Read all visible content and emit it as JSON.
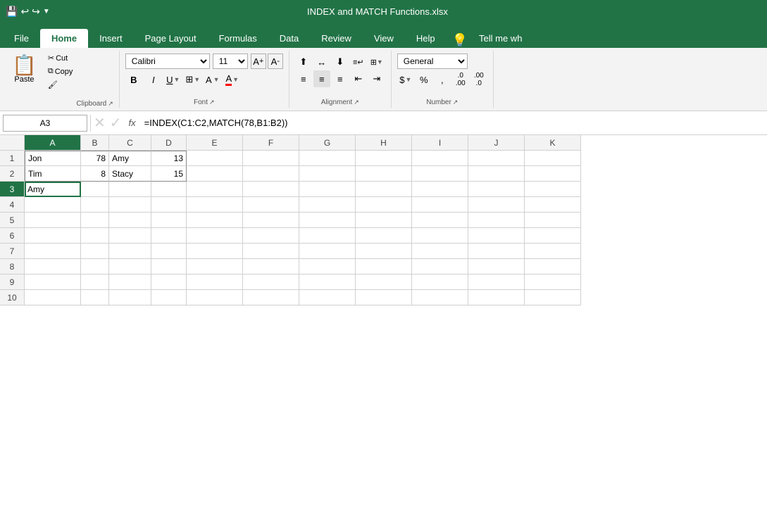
{
  "titlebar": {
    "title": "INDEX and MATCH Functions.xlsx",
    "save_icon": "💾",
    "undo_icon": "↩",
    "redo_icon": "↪"
  },
  "ribbon_tabs": [
    {
      "label": "File",
      "active": false
    },
    {
      "label": "Home",
      "active": true
    },
    {
      "label": "Insert",
      "active": false
    },
    {
      "label": "Page Layout",
      "active": false
    },
    {
      "label": "Formulas",
      "active": false
    },
    {
      "label": "Data",
      "active": false
    },
    {
      "label": "Review",
      "active": false
    },
    {
      "label": "View",
      "active": false
    },
    {
      "label": "Help",
      "active": false
    },
    {
      "label": "Tell me wh",
      "active": false
    }
  ],
  "ribbon": {
    "clipboard": {
      "label": "Clipboard",
      "paste_label": "Paste",
      "cut_label": "Cut",
      "copy_label": "Copy",
      "format_painter_label": "Format Painter"
    },
    "font": {
      "label": "Font",
      "font_name": "Calibri",
      "font_size": "11",
      "bold": "B",
      "italic": "I",
      "underline": "U"
    },
    "alignment": {
      "label": "Alignment"
    },
    "number": {
      "label": "Number",
      "format": "General"
    }
  },
  "formula_bar": {
    "cell_ref": "A3",
    "formula": "=INDEX(C1:C2,MATCH(78,B1:B2))",
    "fx_label": "fx"
  },
  "spreadsheet": {
    "columns": [
      "A",
      "B",
      "C",
      "D",
      "E",
      "F",
      "G",
      "H",
      "I",
      "J",
      "K"
    ],
    "active_col": "A",
    "active_row": 3,
    "cells": {
      "A1": "Jon",
      "B1": "78",
      "C1": "Amy",
      "D1": "13",
      "A2": "Tim",
      "B2": "8",
      "C2": "Stacy",
      "D2": "15",
      "A3": "Amy"
    },
    "rows": 10
  }
}
